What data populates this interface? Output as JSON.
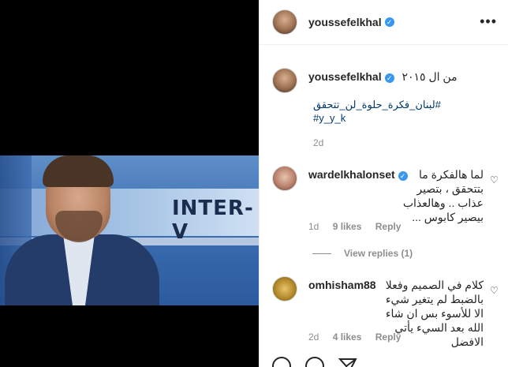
{
  "media": {
    "overlay_text": "INTER-V"
  },
  "post": {
    "author": "youssefelkhal",
    "caption_author": "youssefelkhal",
    "caption_text": "من ال ٢٠١٥",
    "hashtags": [
      "#لبنان_فكرة_حلوة_لن_تتحقق",
      "#y_y_k"
    ],
    "time": "2d"
  },
  "comments": [
    {
      "user": "wardelkhalonset",
      "verified": true,
      "text": "لما هالفكرة ما بتتحقق ، بتصير عذاب .. وهالعذاب بيصير كابوس ...",
      "time": "1d",
      "likes": "9 likes",
      "reply_label": "Reply",
      "view_replies": "View replies (1)"
    },
    {
      "user": "omhisham88",
      "verified": false,
      "text": "كلام في الصميم وفعلا بالضبط لم يتغير شيء الا للأسوء بس ان شاء الله بعد السيء يأتي الافضل",
      "time": "2d",
      "likes": "4 likes",
      "reply_label": "Reply"
    }
  ],
  "icons": {
    "more": "more-options-icon",
    "verified": "verified-badge-icon",
    "heart": "heart-icon",
    "comment": "comment-icon",
    "share": "share-icon"
  },
  "colors": {
    "verified": "#3897f0",
    "hashtag": "#00376b",
    "meta": "#8e8e8e"
  }
}
